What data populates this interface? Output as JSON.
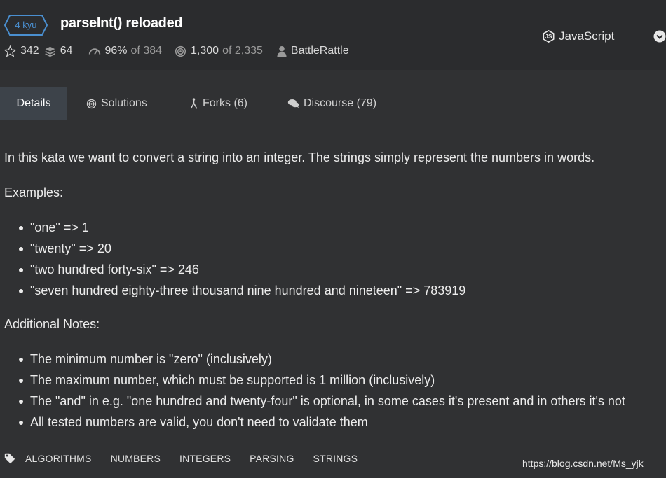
{
  "header": {
    "rank": "4 kyu",
    "title": "parseInt() reloaded",
    "stats": {
      "stars": "342",
      "collections": "64",
      "satisfaction": "96%",
      "satisfaction_of": "of 384",
      "completed": "1,300",
      "completed_of": "of 2,335",
      "author": "BattleRattle"
    },
    "language": "JavaScript"
  },
  "tabs": [
    {
      "label": "Details",
      "icon": "none"
    },
    {
      "label": "Solutions",
      "icon": "target-icon"
    },
    {
      "label": "Forks (6)",
      "icon": "fork-icon"
    },
    {
      "label": "Discourse (79)",
      "icon": "chat-icon"
    }
  ],
  "description": {
    "intro": "In this kata we want to convert a string into an integer. The strings simply represent the numbers in words.",
    "examples_heading": "Examples:",
    "examples": [
      "\"one\" => 1",
      "\"twenty\" => 20",
      "\"two hundred forty-six\" => 246",
      "\"seven hundred eighty-three thousand nine hundred and nineteen\" => 783919"
    ],
    "notes_heading": "Additional Notes:",
    "notes": [
      "The minimum number is \"zero\" (inclusively)",
      "The maximum number, which must be supported is 1 million (inclusively)",
      "The \"and\" in e.g. \"one hundred and twenty-four\" is optional, in some cases it's present and in others it's not",
      "All tested numbers are valid, you don't need to validate them"
    ]
  },
  "tags": [
    "ALGORITHMS",
    "NUMBERS",
    "INTEGERS",
    "PARSING",
    "STRINGS"
  ],
  "watermark": "https://blog.csdn.net/Ms_yjk",
  "colors": {
    "background": "#303133",
    "rank_blue": "#4a8fd0",
    "active_tab": "#3d434a"
  }
}
